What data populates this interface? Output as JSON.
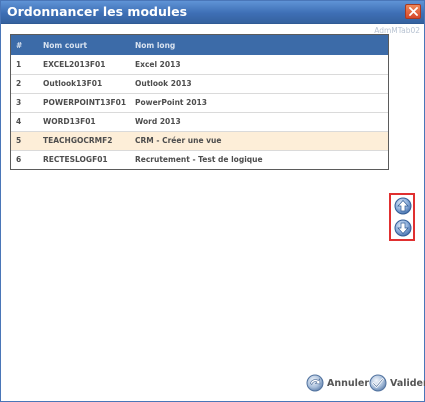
{
  "window": {
    "title": "Ordonnancer les modules",
    "watermark": "AdmMTab02"
  },
  "table": {
    "headers": {
      "num": "#",
      "short": "Nom court",
      "long": "Nom long"
    },
    "rows": [
      {
        "num": "1",
        "short": "EXCEL2013F01",
        "long": "Excel 2013"
      },
      {
        "num": "2",
        "short": "Outlook13F01",
        "long": "Outlook 2013"
      },
      {
        "num": "3",
        "short": "POWERPOINT13F01",
        "long": "PowerPoint 2013"
      },
      {
        "num": "4",
        "short": "WORD13F01",
        "long": "Word 2013"
      },
      {
        "num": "5",
        "short": "TEACHGOCRMF2",
        "long": "CRM - Créer une vue"
      },
      {
        "num": "6",
        "short": "RECTESLOGF01",
        "long": "Recrutement - Test de logique"
      }
    ],
    "selected_row": "5"
  },
  "buttons": {
    "cancel": "Annuler",
    "validate": "Valider"
  },
  "icons": {
    "move_up": "arrow-up-icon",
    "move_down": "arrow-down-icon",
    "close": "close-icon",
    "cancel": "cancel-icon",
    "validate": "checkmark-icon"
  },
  "colors": {
    "titlebar": "#3e6fb5",
    "header_row": "#3c6ba8",
    "selected_row": "#fdeed8",
    "highlight_border": "#e03030",
    "close_button": "#d6472a"
  }
}
